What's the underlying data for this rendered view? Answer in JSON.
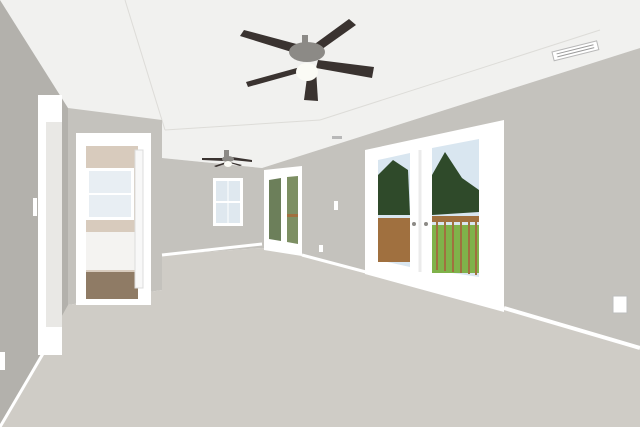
{
  "scene": {
    "colors": {
      "ceiling": "#f1f1ef",
      "wall": "#c4c2bd",
      "wall_shade": "#b3b1ac",
      "carpet": "#cfccc6",
      "trim": "#ffffff",
      "fan_blade": "#3a3330",
      "fan_metal": "#8c8a86",
      "sky": "#d9e6f0",
      "grass": "#7fb24a",
      "trees": "#2f4a2a",
      "deck_rail": "#a0703f",
      "bathroom_wall": "#d8cbbd",
      "bathroom_floor": "#8f7b65"
    },
    "icons": [
      "ceiling-fan-icon",
      "vent-icon",
      "outlet-icon",
      "light-switch-icon"
    ]
  }
}
